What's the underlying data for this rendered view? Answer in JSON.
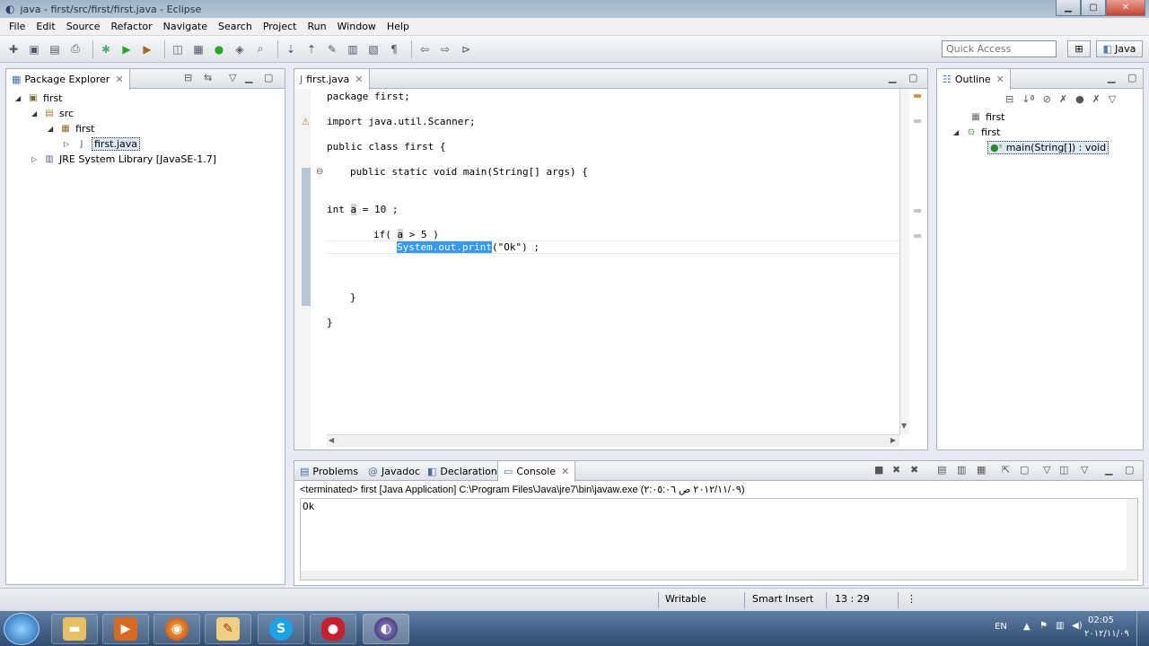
{
  "window": {
    "title": "java - first/src/first/first.java - Eclipse"
  },
  "menu": [
    "File",
    "Edit",
    "Source",
    "Refactor",
    "Navigate",
    "Search",
    "Project",
    "Run",
    "Window",
    "Help"
  ],
  "toolbar": {
    "quick_access_placeholder": "Quick Access",
    "perspective_label": "Java"
  },
  "package_explorer": {
    "tab_label": "Package Explorer",
    "tree": [
      {
        "label": "first",
        "level": 0,
        "expanded": true
      },
      {
        "label": "src",
        "level": 1,
        "expanded": true
      },
      {
        "label": "first",
        "level": 2,
        "expanded": true
      },
      {
        "label": "first.java",
        "level": 3,
        "expanded": false,
        "selected": true
      },
      {
        "label": "JRE System Library [JavaSE-1.7]",
        "level": 1,
        "expanded": false
      }
    ]
  },
  "editor": {
    "tab_label": "first.java",
    "lines": {
      "l1": "package first;",
      "l2": "import java.util.Scanner;",
      "l3": "public class first {",
      "l4": "public static void main(String[] args) {",
      "l5a": "int ",
      "l5b": "a",
      "l5c": " = 10 ;",
      "l6a": "if( ",
      "l6b": "a",
      "l6c": " > 5 )",
      "l7a": "System.out.print",
      "l7b": "(\"Ok\") ;",
      "l8": "}",
      "l9": "}"
    }
  },
  "outline": {
    "tab_label": "Outline",
    "items": [
      {
        "label": "first",
        "kind": "package"
      },
      {
        "label": "first",
        "kind": "class"
      },
      {
        "label": "main(String[]) : void",
        "kind": "method"
      }
    ]
  },
  "bottom": {
    "tabs": [
      "Problems",
      "Javadoc",
      "Declaration",
      "Console"
    ],
    "active_tab": "Console",
    "terminated_line": "<terminated> first [Java Application] C:\\Program Files\\Java\\jre7\\bin\\javaw.exe (٢٠١٢/١١/٠٩ ص ٢:٠٥:٠٦)",
    "output": "Ok"
  },
  "status": {
    "writable": "Writable",
    "insert_mode": "Smart Insert",
    "position": "13 : 29"
  },
  "taskbar": {
    "apps": [
      "windows-explorer",
      "media-player",
      "firefox",
      "paint",
      "skype",
      "recorder",
      "eclipse"
    ],
    "time": "02:05",
    "date": "٢٠١٢/١١/٠٩",
    "lang": "EN"
  },
  "colors": {
    "selection": "#3399ff",
    "taskbar": "#3c5b82"
  }
}
